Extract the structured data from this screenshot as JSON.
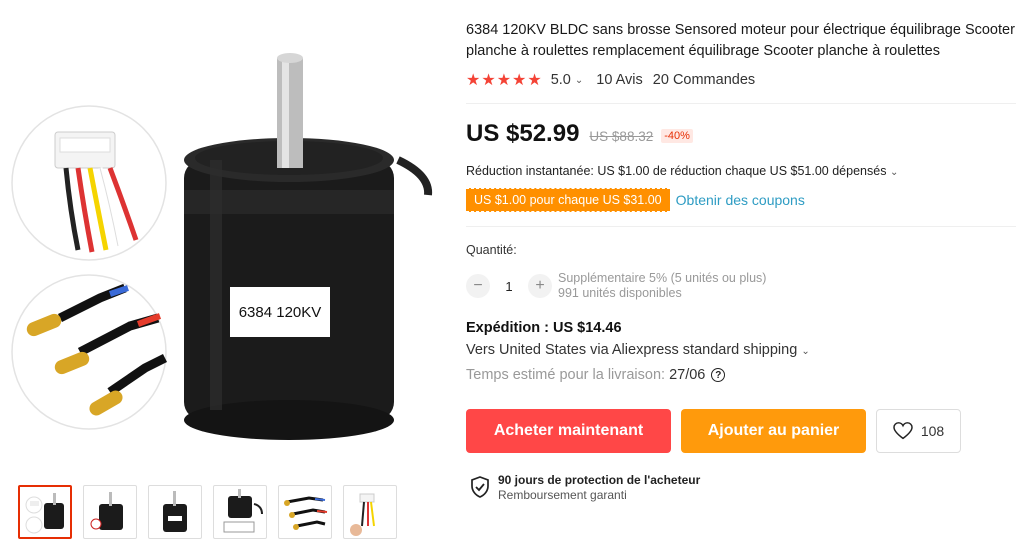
{
  "product": {
    "title": "6384 120KV BLDC sans brosse Sensored moteur pour électrique équilibrage Scooter planche à roulettes remplacement équilibrage Scooter planche à roulettes",
    "motor_label": "6384 120KV"
  },
  "rating": {
    "stars": 5,
    "value": "5.0",
    "reviews": "10 Avis",
    "orders": "20 Commandes"
  },
  "price": {
    "current": "US $52.99",
    "original": "US $88.32",
    "discount": "-40%"
  },
  "promo": {
    "instant_reduction": "Réduction instantanée: US $1.00 de réduction chaque US $51.00 dépensés",
    "coupon_tag": "US $1.00 pour chaque US $31.00",
    "coupon_link": "Obtenir des coupons"
  },
  "quantity": {
    "label": "Quantité:",
    "value": "1",
    "decrement": "−",
    "increment": "+",
    "bulk_note": "Supplémentaire 5% (5 unités ou plus)",
    "available": "991 unités disponibles"
  },
  "shipping": {
    "title": "Expédition : US $14.46",
    "method": "Vers United States via Aliexpress standard shipping",
    "estimate_label": "Temps estimé pour la livraison:",
    "estimate_date": "27/06"
  },
  "actions": {
    "buy_now": "Acheter maintenant",
    "add_to_cart": "Ajouter au panier",
    "wishlist_count": "108"
  },
  "protection": {
    "title": "90 jours de protection de l'acheteur",
    "subtitle": "Remboursement garanti"
  },
  "colors": {
    "accent_red": "#ff4747",
    "accent_orange": "#ff9a0c",
    "star_red": "#f44336",
    "link_blue": "#2e9cc3"
  }
}
